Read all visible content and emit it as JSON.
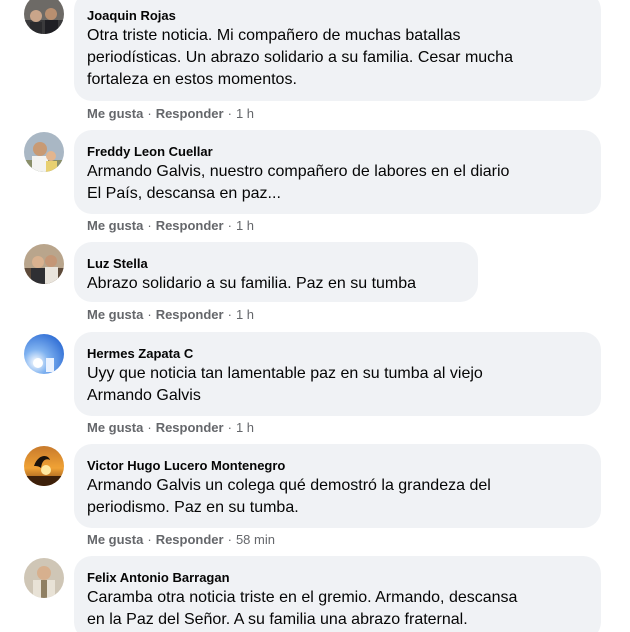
{
  "comments": [
    {
      "author": "Joaquin Rojas",
      "text": "Otra triste noticia. Mi compañero de muchas batallas\nperiodísticas. Un abrazo solidario a su familia. Cesar mucha\nfortaleza en estos momentos.",
      "like": "Me gusta",
      "reply": "Responder",
      "time": "1 h"
    },
    {
      "author": "Freddy Leon Cuellar",
      "text": "Armando Galvis, nuestro compañero de labores en el diario\nEl País, descansa en paz...",
      "like": "Me gusta",
      "reply": "Responder",
      "time": "1 h"
    },
    {
      "author": "Luz Stella",
      "text": "Abrazo solidario a su familia. Paz en su tumba",
      "like": "Me gusta",
      "reply": "Responder",
      "time": "1 h"
    },
    {
      "author": "Hermes Zapata C",
      "text": "Uyy que noticia tan lamentable paz en su tumba al viejo\nArmando Galvis",
      "like": "Me gusta",
      "reply": "Responder",
      "time": "1 h"
    },
    {
      "author": "Victor Hugo Lucero Montenegro",
      "text": "Armando Galvis un colega qué demostró la grandeza del\nperiodismo. Paz en su tumba.",
      "like": "Me gusta",
      "reply": "Responder",
      "time": "58 min"
    },
    {
      "author": "Felix Antonio Barragan",
      "text": "Caramba otra noticia triste en el gremio. Armando, descansa\nen la Paz del Señor. A su familia una abrazo fraternal.",
      "like": "",
      "reply": "",
      "time": ""
    }
  ],
  "separator": "·",
  "colors": {
    "bubble": "#f0f2f5",
    "text": "#050505",
    "secondary": "#65676b"
  }
}
